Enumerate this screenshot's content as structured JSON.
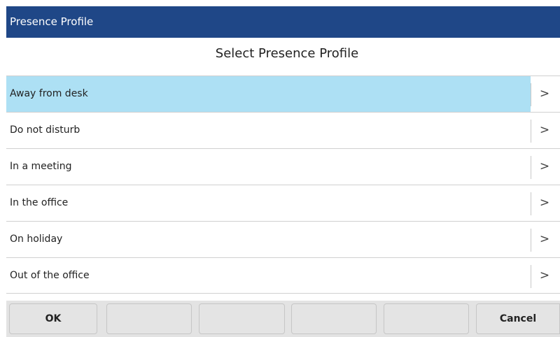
{
  "window": {
    "title": "Presence Profile"
  },
  "header": {
    "subtitle": "Select Presence Profile"
  },
  "profiles": [
    {
      "label": "Away from desk",
      "selected": true,
      "icon": "chevron-right-icon"
    },
    {
      "label": "Do not disturb",
      "selected": false,
      "icon": "chevron-right-icon"
    },
    {
      "label": "In a meeting",
      "selected": false,
      "icon": "chevron-right-icon"
    },
    {
      "label": "In the office",
      "selected": false,
      "icon": "chevron-right-icon"
    },
    {
      "label": "On holiday",
      "selected": false,
      "icon": "chevron-right-icon"
    },
    {
      "label": "Out of the office",
      "selected": false,
      "icon": "chevron-right-icon"
    }
  ],
  "chevron_glyph": ">",
  "softkeys": [
    {
      "label": "OK"
    },
    {
      "label": ""
    },
    {
      "label": ""
    },
    {
      "label": ""
    },
    {
      "label": ""
    },
    {
      "label": "Cancel"
    }
  ],
  "colors": {
    "title_bar": "#1f4787",
    "selected_row": "#ade0f4",
    "softkey_bar": "#e3e3e3"
  }
}
